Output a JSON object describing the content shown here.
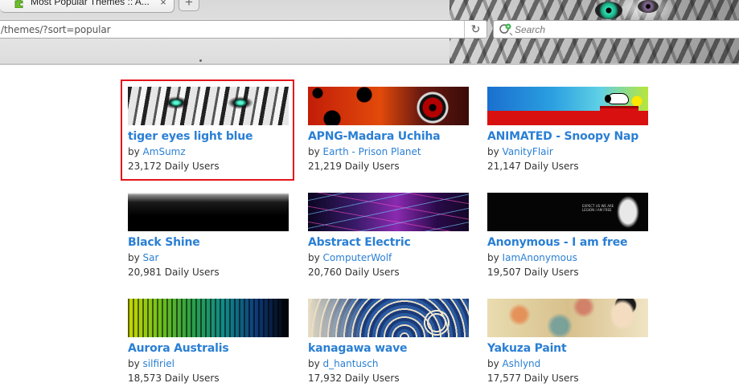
{
  "browser": {
    "tab_title": "Most Popular Themes :: A...",
    "tab_close": "×",
    "new_tab": "+",
    "url": "/themes/?sort=popular",
    "reload": "↻",
    "search_placeholder": "Search"
  },
  "themes": [
    {
      "name": "tiger eyes light blue",
      "by_prefix": "by ",
      "author": "AmSumz",
      "users": "23,172 Daily Users",
      "thumb": "tiger"
    },
    {
      "name": "APNG-Madara Uchiha",
      "by_prefix": "by ",
      "author": "Earth - Prison Planet",
      "users": "21,219 Daily Users",
      "thumb": "madara"
    },
    {
      "name": "ANIMATED - Snoopy Nap",
      "by_prefix": "by ",
      "author": "VanityFlair",
      "users": "21,147 Daily Users",
      "thumb": "snoopy"
    },
    {
      "name": "Black Shine",
      "by_prefix": "by ",
      "author": "Sar",
      "users": "20,981 Daily Users",
      "thumb": "blackshine"
    },
    {
      "name": "Abstract Electric",
      "by_prefix": "by ",
      "author": "ComputerWolf",
      "users": "20,760 Daily Users",
      "thumb": "electric"
    },
    {
      "name": "Anonymous - I am free",
      "by_prefix": "by ",
      "author": "IamAnonymous",
      "users": "19,507 Daily Users",
      "thumb": "anon"
    },
    {
      "name": "Aurora Australis",
      "by_prefix": "by ",
      "author": "silfiriel",
      "users": "18,573 Daily Users",
      "thumb": "aurora"
    },
    {
      "name": "kanagawa wave",
      "by_prefix": "by ",
      "author": "d_hantusch",
      "users": "17,932 Daily Users",
      "thumb": "wave"
    },
    {
      "name": "Yakuza Paint",
      "by_prefix": "by ",
      "author": "Ashlynd",
      "users": "17,577 Daily Users",
      "thumb": "yakuza"
    }
  ],
  "anon_thumb_text": "EXPECT US WE ARE LEGION I AM FREE",
  "colors": {
    "link": "#2a7fd4",
    "highlight": "#e5141b"
  }
}
